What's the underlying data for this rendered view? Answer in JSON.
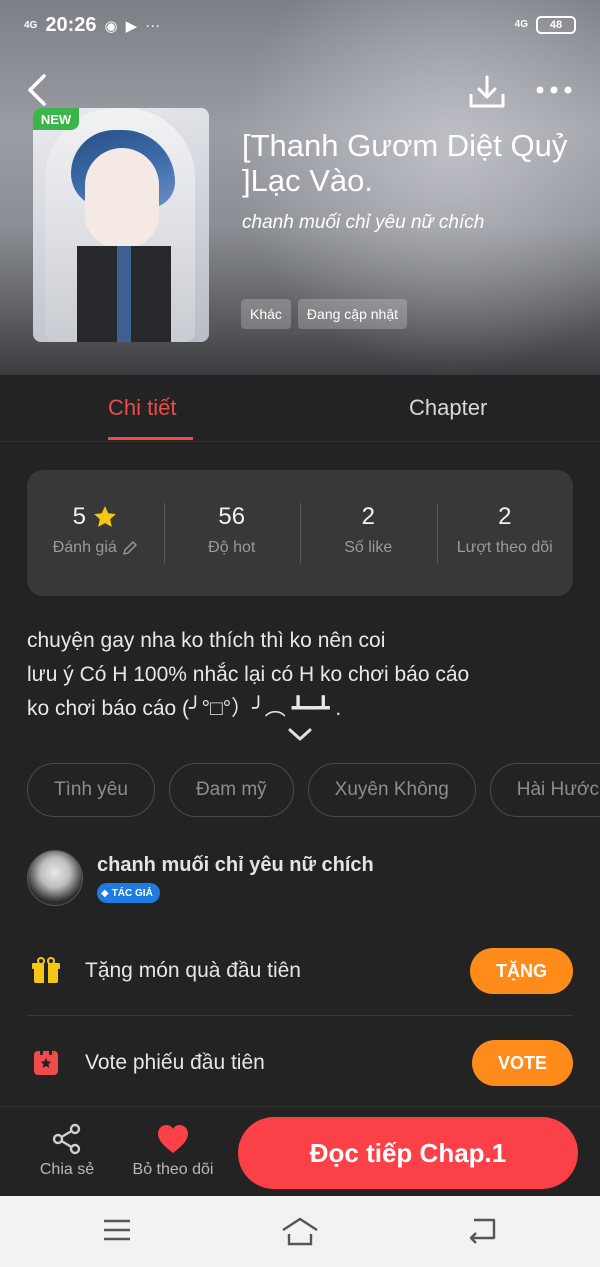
{
  "status_bar": {
    "signal_left": "4G",
    "time": "20:26",
    "signal_right": "4G",
    "battery": "48"
  },
  "book": {
    "badge": "NEW",
    "title": "[Thanh Gươm Diệt Quỷ ]Lạc Vào.",
    "author": "chanh muối chỉ yêu nữ chích",
    "tags": [
      "Khác",
      "Đang cập nhật"
    ]
  },
  "tabs": {
    "detail": "Chi tiết",
    "chapter": "Chapter"
  },
  "stats": [
    {
      "value": "5",
      "label": "Đánh giá"
    },
    {
      "value": "56",
      "label": "Độ hot"
    },
    {
      "value": "2",
      "label": "Số like"
    },
    {
      "value": "2",
      "label": "Lượt theo dõi"
    }
  ],
  "description": {
    "line1": "chuyện gay nha ko thích thì ko nên coi",
    "line2": "lưu ý Có H 100% nhắc lại có H ko chơi báo cáo",
    "line3": "ko chơi báo cáo (╯°□°）╯︵ ┻━┻ ."
  },
  "genres": [
    "Tình yêu",
    "Đam mỹ",
    "Xuyên Không",
    "Hài Hước"
  ],
  "author_section": {
    "name": "chanh muối chỉ yêu nữ chích",
    "badge": "TÁC GIẢ"
  },
  "actions": {
    "gift_text": "Tặng món quà đầu tiên",
    "gift_button": "TẶNG",
    "vote_text": "Vote phiếu đầu tiên",
    "vote_button": "VOTE"
  },
  "bottom_bar": {
    "share": "Chia sẻ",
    "follow": "Bỏ theo dõi",
    "read": "Đọc tiếp Chap.1"
  },
  "colors": {
    "accent": "#fb4147",
    "orange": "#ff8c1a",
    "new_badge": "#3bb54a",
    "author_badge": "#1f7be0"
  }
}
